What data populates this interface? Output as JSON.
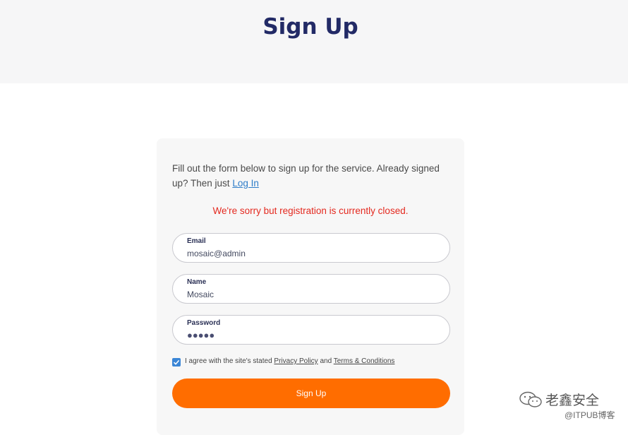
{
  "header": {
    "title": "Sign Up"
  },
  "form": {
    "intro_text": "Fill out the form below to sign up for the service. Already signed up? Then just ",
    "login_link": "Log In",
    "error_message": "We're sorry but registration is currently closed.",
    "email": {
      "label": "Email",
      "value": "mosaic@admin"
    },
    "name": {
      "label": "Name",
      "value": "Mosaic"
    },
    "password": {
      "label": "Password",
      "masked_value": "●●●●●"
    },
    "agree": {
      "checked": true,
      "text_before": "I agree with the site's stated ",
      "privacy_link": "Privacy Policy",
      "text_middle": " and ",
      "terms_link": "Terms & Conditions"
    },
    "submit_label": "Sign Up"
  },
  "watermark": {
    "title": "老鑫安全",
    "subtitle": "@ITPUB博客"
  },
  "colors": {
    "accent": "#ff6d00",
    "title": "#222a66",
    "error": "#e4291f",
    "link": "#2d7cc8"
  }
}
